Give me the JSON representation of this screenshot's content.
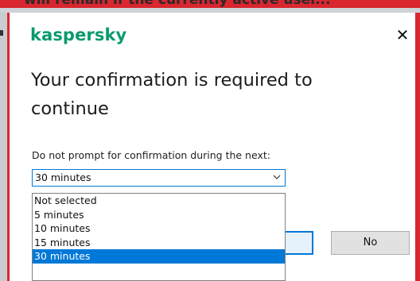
{
  "background": {
    "partial_text": "will remain if the currently active user..."
  },
  "dialog": {
    "brand": "kaspersky",
    "close_glyph": "✕",
    "title": "Your confirmation is required to continue",
    "prompt": "Do not prompt for confirmation during the next:",
    "duration_select": {
      "value": "30 minutes",
      "options": [
        "Not selected",
        "5 minutes",
        "10 minutes",
        "15 minutes",
        "30 minutes"
      ],
      "selected": "30 minutes"
    },
    "buttons": {
      "primary_label": "",
      "no_label": "No"
    }
  },
  "colors": {
    "brand_green": "#0a9a6f",
    "accent_blue": "#0078d7",
    "background_red": "#d9262f"
  },
  "icons": {
    "close": "close-icon",
    "dropdown": "chevron-down-icon"
  }
}
